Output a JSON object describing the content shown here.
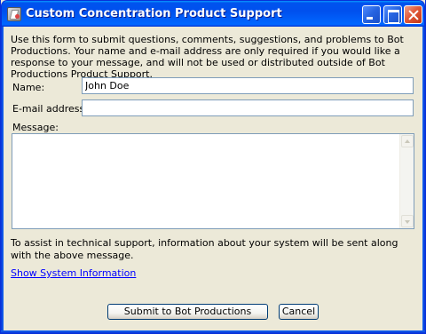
{
  "window": {
    "title": "Custom Concentration Product Support"
  },
  "intro": {
    "text": "Use this form to submit questions, comments, suggestions, and problems to Bot Productions. Your name and e-mail address are only required if you would like a response to your message, and will not be used or distributed outside of Bot Productions Product Support."
  },
  "form": {
    "name_label": "Name:",
    "name_value": "John Doe",
    "email_label": "E-mail address:",
    "email_value": "",
    "message_label": "Message:",
    "message_value": ""
  },
  "notice": {
    "text": "To assist in technical support, information about your system will be sent along with the above message."
  },
  "link": {
    "label": "Show System Information"
  },
  "buttons": {
    "submit_label": "Submit to Bot Productions",
    "cancel_label": "Cancel"
  },
  "colors": {
    "titlebar": "#0054e3",
    "dialog_bg": "#ece9d8",
    "link": "#0000ff",
    "field_border": "#7f9db9"
  }
}
